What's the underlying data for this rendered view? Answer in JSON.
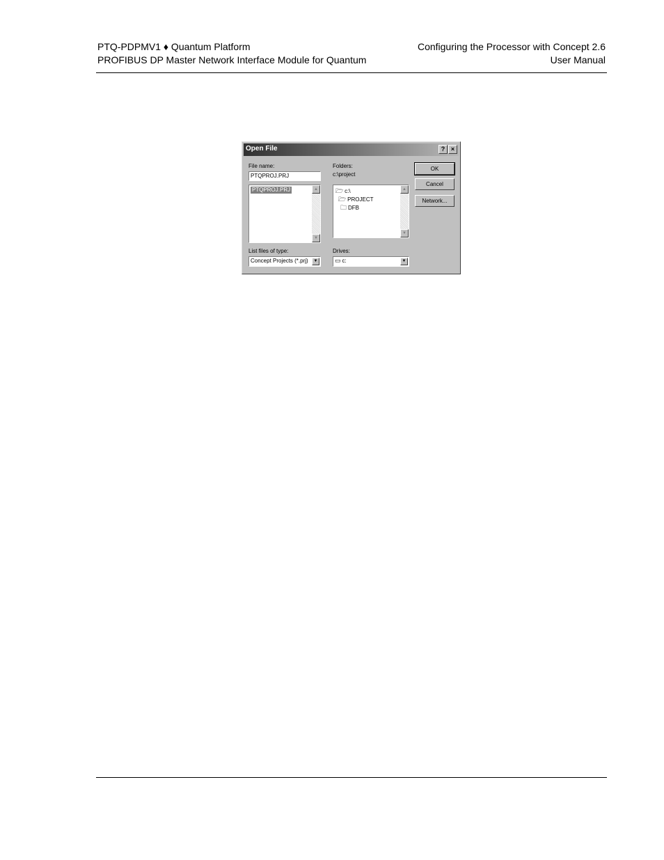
{
  "header": {
    "left_line1": "PTQ-PDPMV1 ♦ Quantum Platform",
    "left_line2": "PROFIBUS DP Master Network Interface Module for Quantum",
    "right_line1": "Configuring the Processor with Concept 2.6",
    "right_line2": "User Manual"
  },
  "dialog": {
    "title": "Open File",
    "help_label": "?",
    "close_label": "×",
    "file_name_label": "File name:",
    "file_name_value": "PTQPROJ.PRJ",
    "file_list": [
      "PTQPROJ.PRJ"
    ],
    "folders_label": "Folders:",
    "current_folder": "c:\\project",
    "folder_tree": [
      "c:\\",
      "PROJECT",
      "DFB"
    ],
    "list_type_label": "List files of type:",
    "list_type_value": "Concept Projects (*.prj)",
    "drives_label": "Drives:",
    "drive_value": "c:",
    "ok_label": "OK",
    "cancel_label": "Cancel",
    "network_label": "Network..."
  }
}
